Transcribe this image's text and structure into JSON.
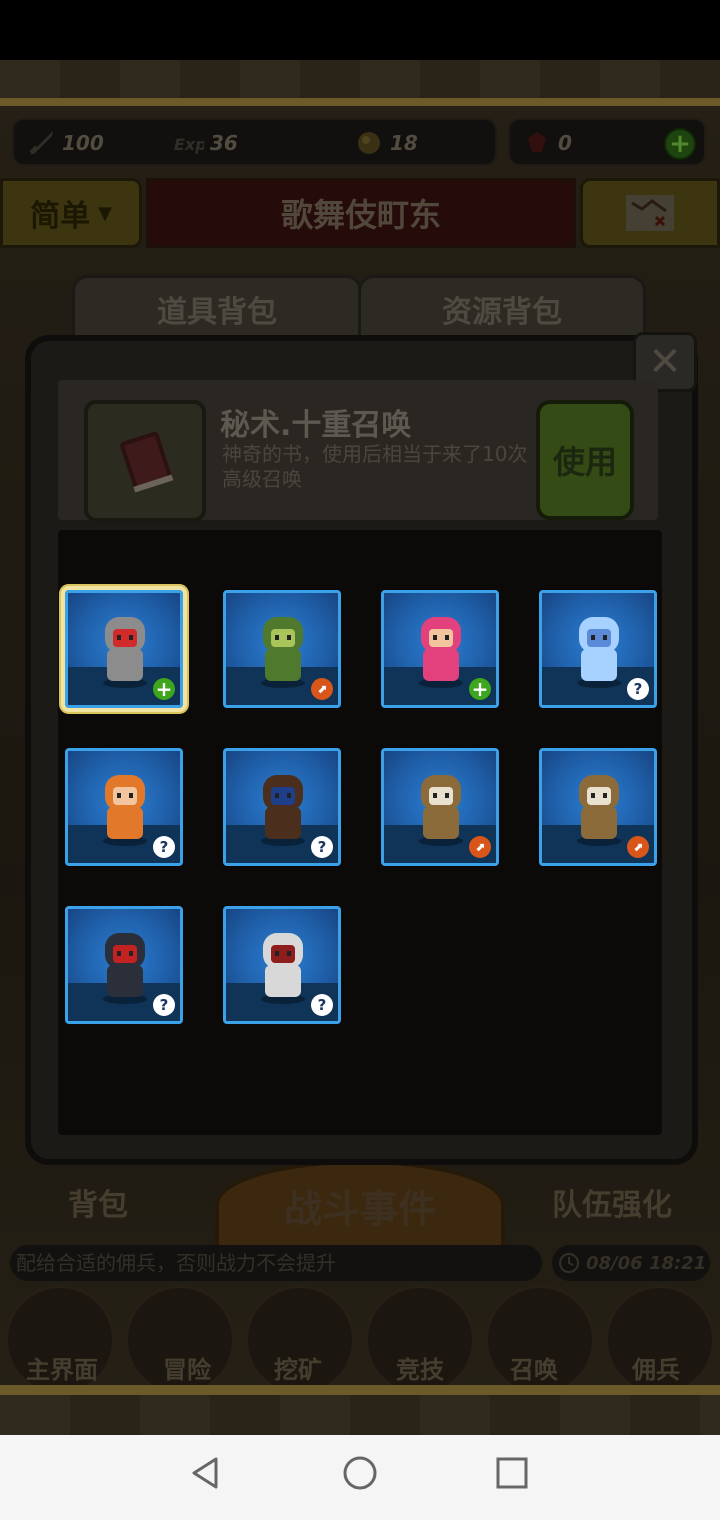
{
  "resources": [
    {
      "icon": "sword-icon",
      "value": "100"
    },
    {
      "icon": "exp-icon",
      "value": "36"
    },
    {
      "icon": "orb-icon",
      "value": "18"
    }
  ],
  "gems": {
    "icon": "gem-icon",
    "value": "0",
    "add": "+"
  },
  "difficulty": {
    "label": "简单",
    "arrow": "▼"
  },
  "stage_title": "歌舞伎町东",
  "tabs": [
    "道具背包",
    "资源背包"
  ],
  "close_label": "✕",
  "item": {
    "name": "秘术.十重召唤",
    "description": "神奇的书，使用后相当于来了10次高级召唤",
    "use_label": "使用"
  },
  "heroes": [
    {
      "name": "robot",
      "badge": "plus",
      "badge_text": "+"
    },
    {
      "name": "green-dragon",
      "badge": "up",
      "badge_text": "⬈"
    },
    {
      "name": "pink-hair-girl",
      "badge": "plus",
      "badge_text": "+"
    },
    {
      "name": "blue-spirit",
      "badge": "q",
      "badge_text": "?"
    },
    {
      "name": "fire-hair-woman",
      "badge": "q",
      "badge_text": "?"
    },
    {
      "name": "brown-hair-boy",
      "badge": "q",
      "badge_text": "?"
    },
    {
      "name": "bearded-monk",
      "badge": "up",
      "badge_text": "⬈"
    },
    {
      "name": "bearded-monk-2",
      "badge": "up",
      "badge_text": "⬈"
    },
    {
      "name": "hooded-reaper",
      "badge": "q",
      "badge_text": "?"
    },
    {
      "name": "white-hair-swordsman",
      "badge": "q",
      "badge_text": "?"
    }
  ],
  "bottom": {
    "left_label": "背包",
    "battle_label": "战斗事件",
    "right_label": "队伍强化",
    "ticker": "配给合适的佣兵，否则战力不会提升",
    "time": "08/06 18:21"
  },
  "nav": [
    "主界面",
    "冒险",
    "挖矿",
    "竞技",
    "召唤",
    "佣兵"
  ],
  "colors": {
    "card_border": "#3ba1e8",
    "selected_glow": "#f1e4a3",
    "use_button": "#344b16"
  }
}
